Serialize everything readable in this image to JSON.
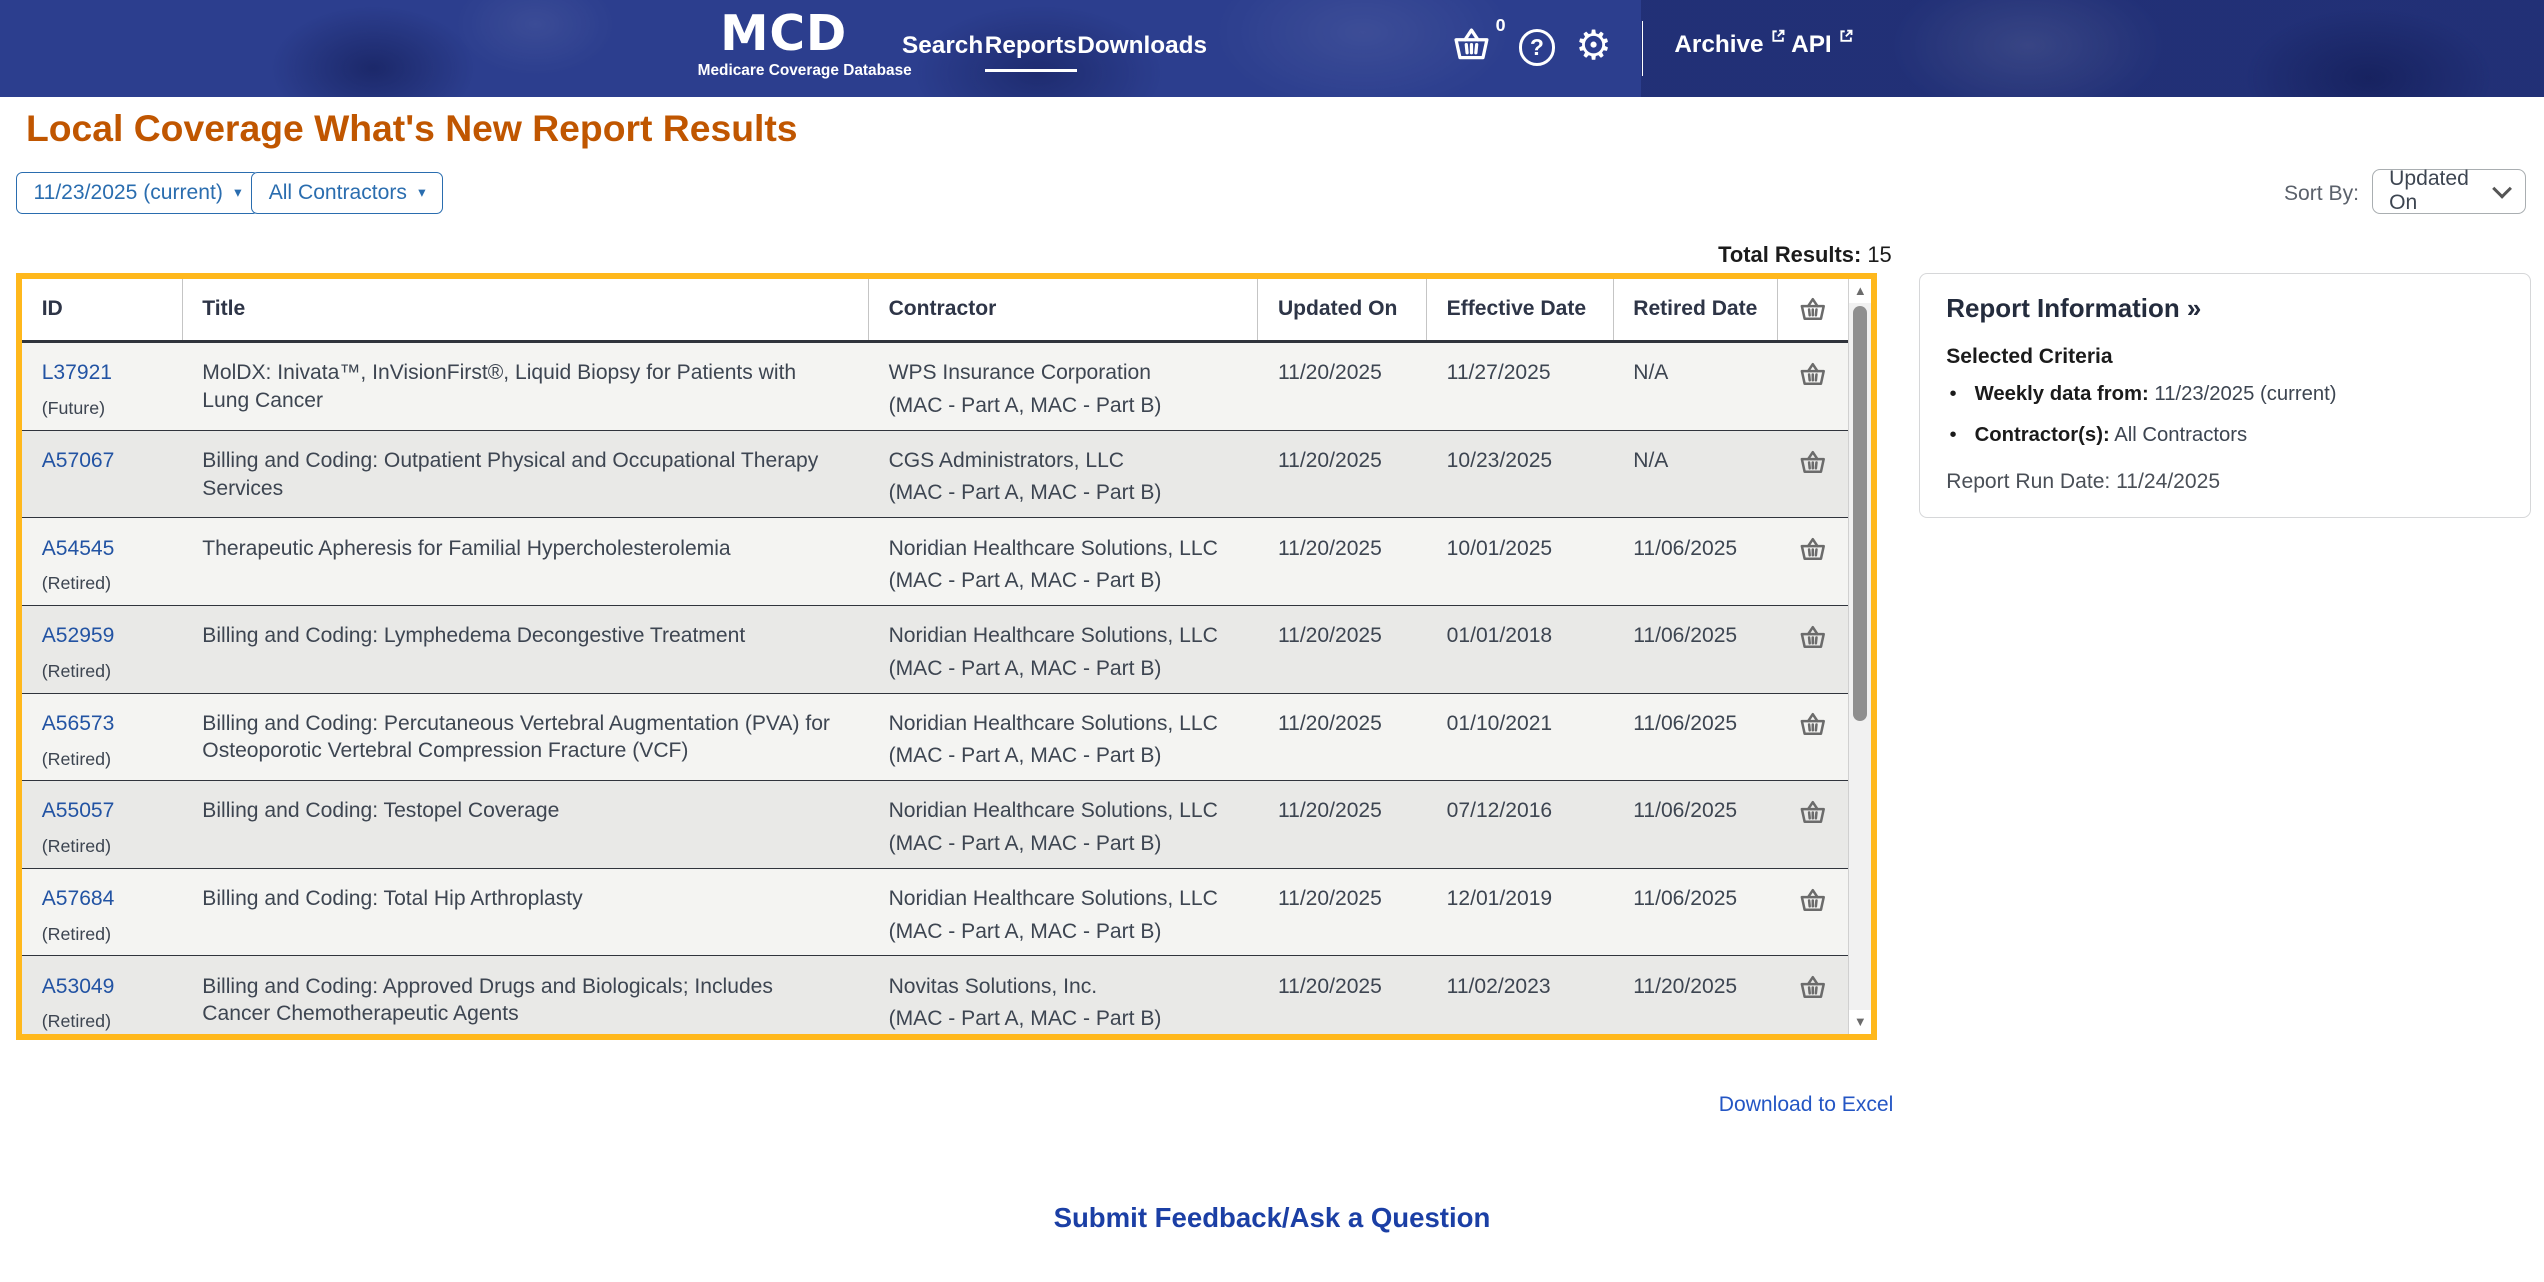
{
  "header": {
    "logo": {
      "title": "MCD",
      "subtitle": "Medicare Coverage Database"
    },
    "nav": [
      {
        "label": "Search",
        "active": false
      },
      {
        "label": "Reports",
        "active": true
      },
      {
        "label": "Downloads",
        "active": false
      }
    ],
    "cart_count": "0",
    "archive_label": "Archive",
    "api_label": "API"
  },
  "icons": {
    "gear": "⚙",
    "help": "?",
    "caret": "▾",
    "up_arrow": "▲",
    "down_arrow": "▼"
  },
  "page": {
    "title": "Local Coverage What's New Report Results",
    "filters": {
      "week": "11/23/2025 (current)",
      "contractor": "All Contractors"
    },
    "sort": {
      "label": "Sort By:",
      "value": "Updated On"
    },
    "total_results_label": "Total Results:",
    "total_results_value": "15",
    "download_link": "Download to Excel",
    "feedback_link": "Submit Feedback/Ask a Question"
  },
  "table": {
    "columns": [
      "ID",
      "Title",
      "Contractor",
      "Updated On",
      "Effective Date",
      "Retired Date"
    ],
    "rows": [
      {
        "id": "L37921",
        "status": "(Future)",
        "title": "MolDX: Inivata™, InVisionFirst®, Liquid Biopsy for Patients with Lung Cancer",
        "contractor": "WPS Insurance Corporation",
        "contractor_type": "(MAC - Part A, MAC - Part B)",
        "updated": "11/20/2025",
        "effective": "11/27/2025",
        "retired": "N/A"
      },
      {
        "id": "A57067",
        "status": "",
        "title": "Billing and Coding: Outpatient Physical and Occupational Therapy Services",
        "contractor": "CGS Administrators, LLC",
        "contractor_type": "(MAC - Part A, MAC - Part B)",
        "updated": "11/20/2025",
        "effective": "10/23/2025",
        "retired": "N/A"
      },
      {
        "id": "A54545",
        "status": "(Retired)",
        "title": "Therapeutic Apheresis for Familial Hypercholesterolemia",
        "contractor": "Noridian Healthcare Solutions, LLC",
        "contractor_type": "(MAC - Part A, MAC - Part B)",
        "updated": "11/20/2025",
        "effective": "10/01/2025",
        "retired": "11/06/2025"
      },
      {
        "id": "A52959",
        "status": "(Retired)",
        "title": "Billing and Coding: Lymphedema Decongestive Treatment",
        "contractor": "Noridian Healthcare Solutions, LLC",
        "contractor_type": "(MAC - Part A, MAC - Part B)",
        "updated": "11/20/2025",
        "effective": "01/01/2018",
        "retired": "11/06/2025"
      },
      {
        "id": "A56573",
        "status": "(Retired)",
        "title": "Billing and Coding: Percutaneous Vertebral Augmentation (PVA) for Osteoporotic Vertebral Compression Fracture (VCF)",
        "contractor": "Noridian Healthcare Solutions, LLC",
        "contractor_type": "(MAC - Part A, MAC - Part B)",
        "updated": "11/20/2025",
        "effective": "01/10/2021",
        "retired": "11/06/2025"
      },
      {
        "id": "A55057",
        "status": "(Retired)",
        "title": "Billing and Coding: Testopel Coverage",
        "contractor": "Noridian Healthcare Solutions, LLC",
        "contractor_type": "(MAC - Part A, MAC - Part B)",
        "updated": "11/20/2025",
        "effective": "07/12/2016",
        "retired": "11/06/2025"
      },
      {
        "id": "A57684",
        "status": "(Retired)",
        "title": "Billing and Coding: Total Hip Arthroplasty",
        "contractor": "Noridian Healthcare Solutions, LLC",
        "contractor_type": "(MAC - Part A, MAC - Part B)",
        "updated": "11/20/2025",
        "effective": "12/01/2019",
        "retired": "11/06/2025"
      },
      {
        "id": "A53049",
        "status": "(Retired)",
        "title": "Billing and Coding: Approved Drugs and Biologicals; Includes Cancer Chemotherapeutic Agents",
        "contractor": "Novitas Solutions, Inc.",
        "contractor_type": "(MAC - Part A, MAC - Part B)",
        "updated": "11/20/2025",
        "effective": "11/02/2023",
        "retired": "11/20/2025"
      }
    ]
  },
  "report_info": {
    "heading": "Report Information »",
    "criteria_heading": "Selected Criteria",
    "criteria": [
      {
        "label": "Weekly data from:",
        "value": "11/23/2025 (current)"
      },
      {
        "label": "Contractor(s):",
        "value": "All Contractors"
      }
    ],
    "run_date_label": "Report Run Date:",
    "run_date_value": "11/24/2025"
  },
  "colors": {
    "accent_gold": "#ffb81c",
    "header_navy": "#2c3e8e",
    "title_orange": "#c05600",
    "link_blue": "#2253a3"
  }
}
